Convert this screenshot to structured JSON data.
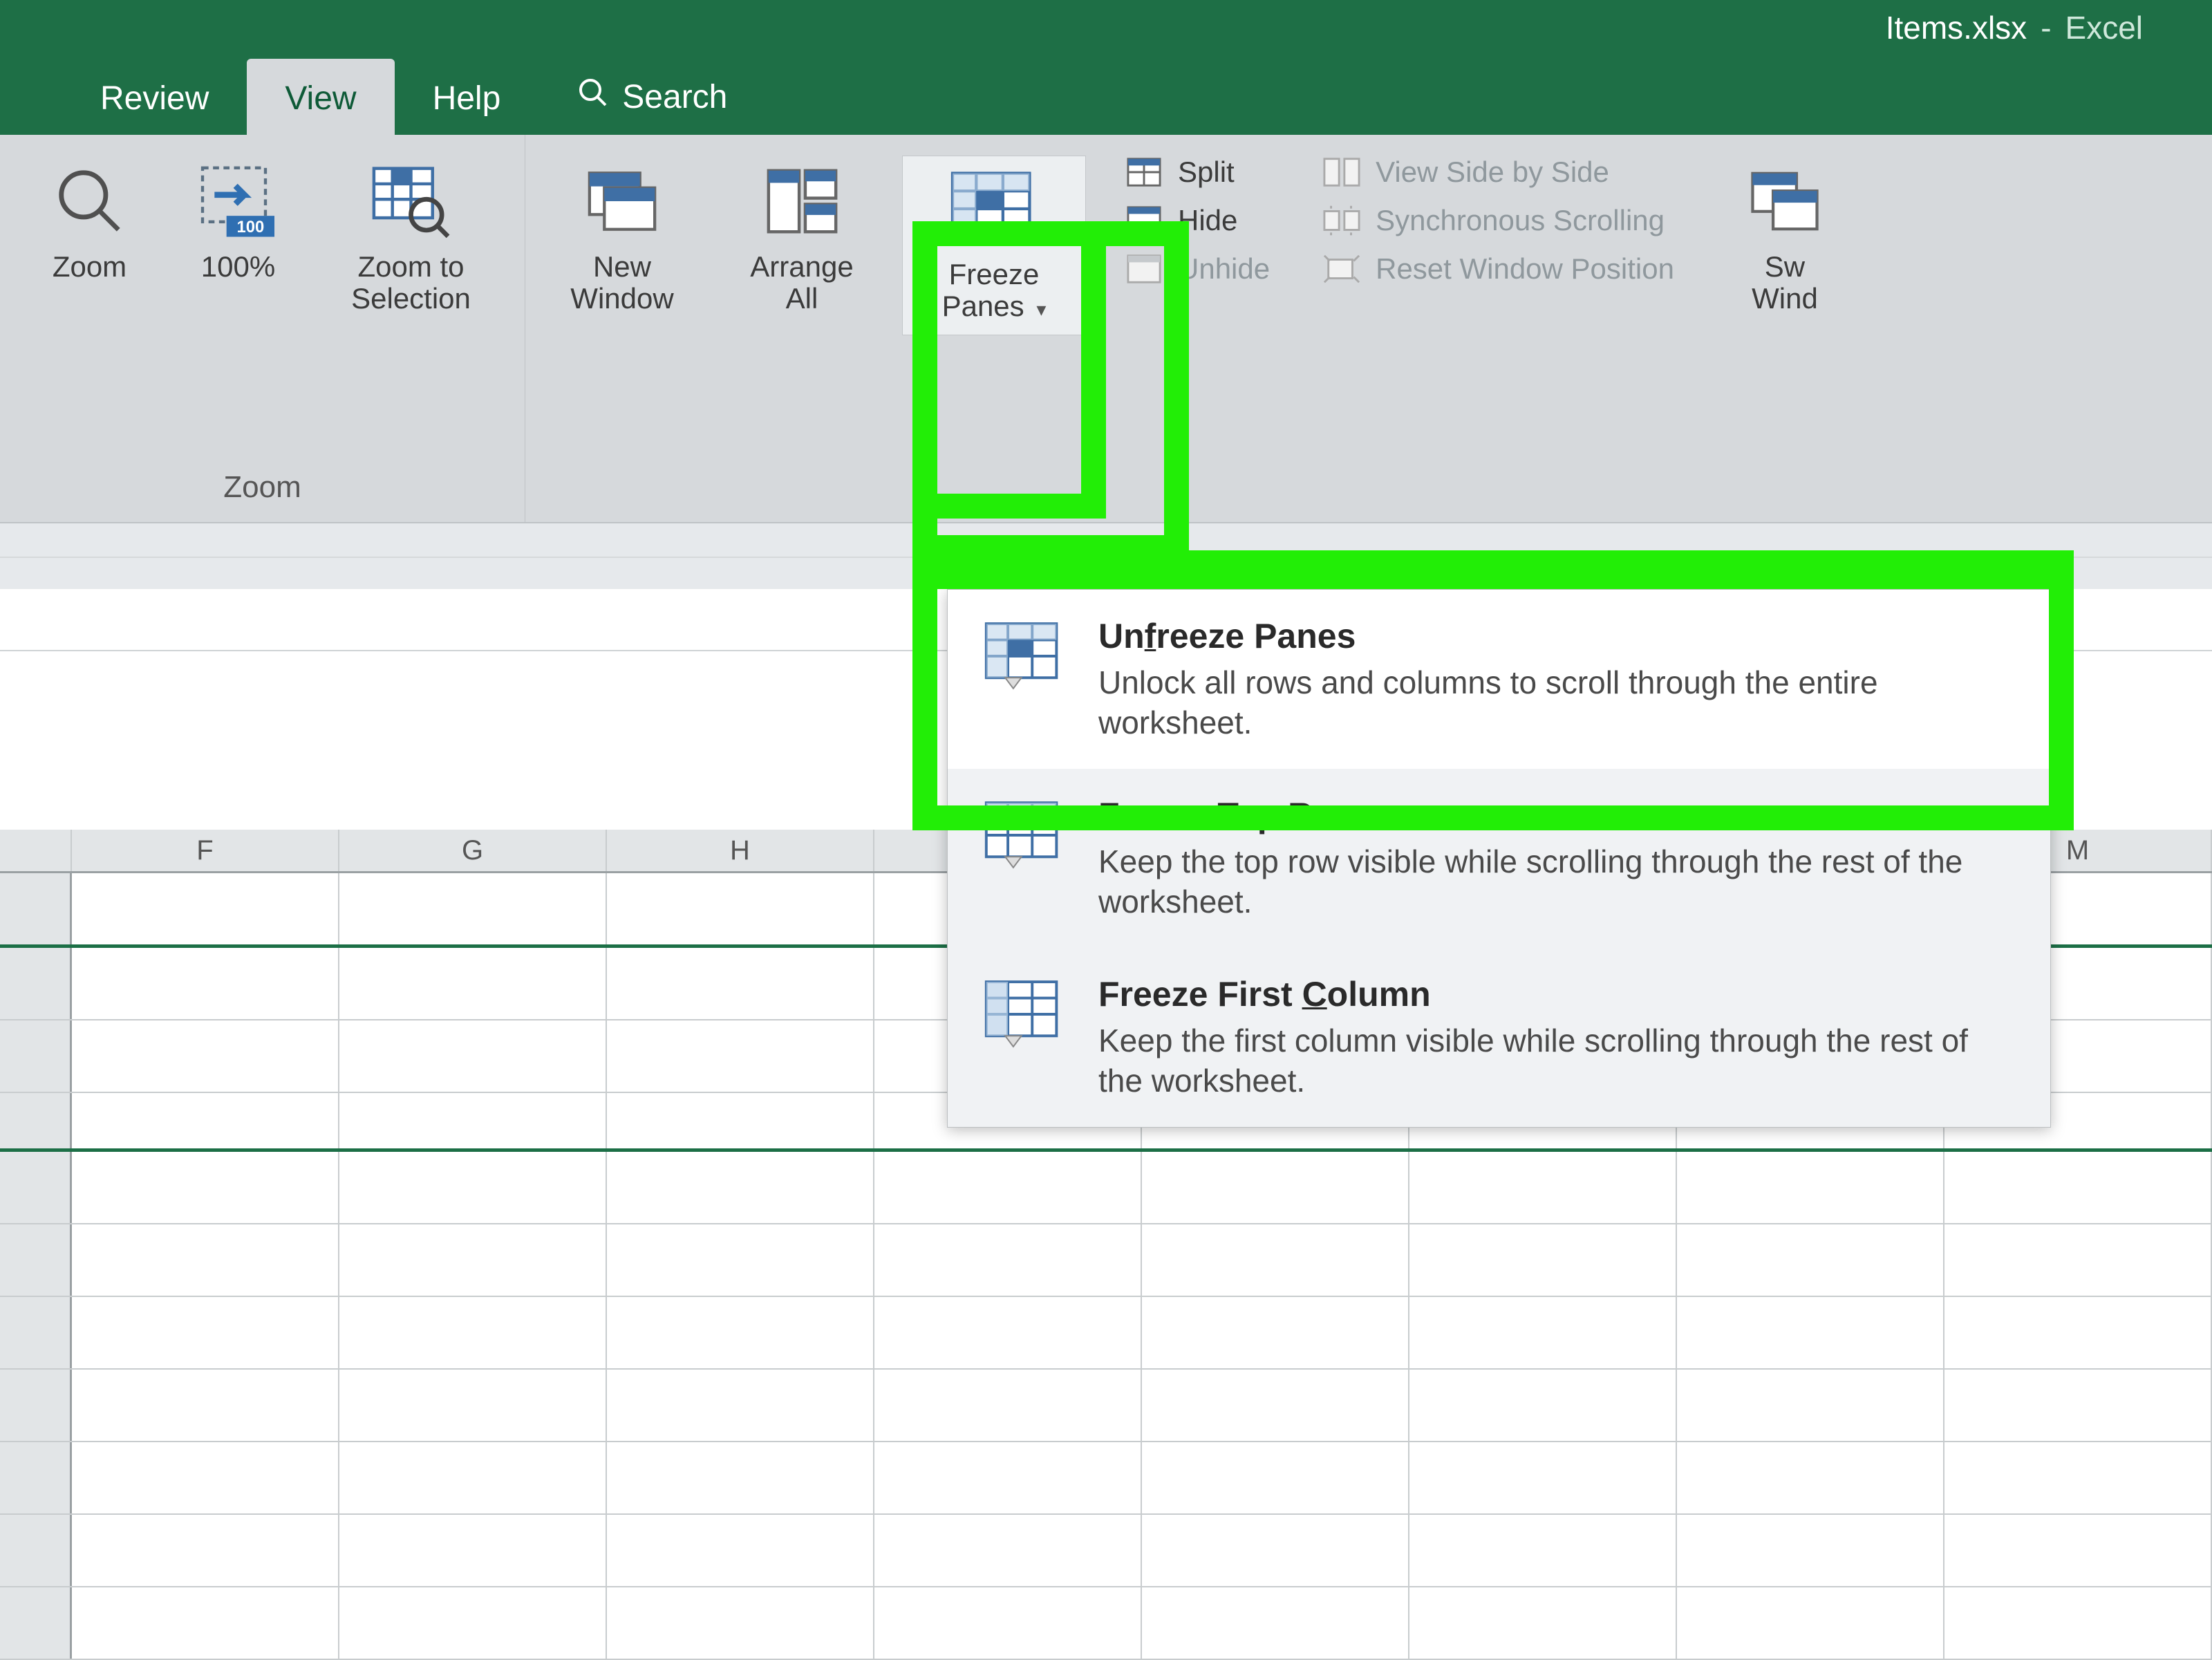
{
  "title": {
    "filename": "Items.xlsx",
    "sep": "-",
    "app": "Excel"
  },
  "tabs": {
    "review": "Review",
    "view": "View",
    "help": "Help",
    "search": "Search"
  },
  "zoom_group": {
    "zoom": "Zoom",
    "hundred": "100%",
    "zoom_selection_l1": "Zoom to",
    "zoom_selection_l2": "Selection",
    "label": "Zoom"
  },
  "window_group": {
    "new_l1": "New",
    "new_l2": "Window",
    "arrange_l1": "Arrange",
    "arrange_l2": "All",
    "freeze_l1": "Freeze",
    "freeze_l2": "Panes",
    "split": "Split",
    "hide": "Hide",
    "unhide": "Unhide",
    "sbs": "View Side by Side",
    "sync": "Synchronous Scrolling",
    "reset": "Reset Window Position",
    "switch_l1": "Sw",
    "switch_l2": "Wind"
  },
  "dropdown": {
    "unfreeze_title_a": "Un",
    "unfreeze_title_b": "f",
    "unfreeze_title_c": "reeze Panes",
    "unfreeze_desc": "Unlock all rows and columns to scroll through the entire worksheet.",
    "toprow_title_a": "Freeze Top ",
    "toprow_title_b": "R",
    "toprow_title_c": "ow",
    "toprow_desc": "Keep the top row visible while scrolling through the rest of the worksheet.",
    "firstcol_title_a": "Freeze First ",
    "firstcol_title_b": "C",
    "firstcol_title_c": "olumn",
    "firstcol_desc": "Keep the first column visible while scrolling through the rest of the worksheet."
  },
  "columns": [
    "F",
    "G",
    "H",
    "",
    "",
    "",
    "",
    "M"
  ]
}
